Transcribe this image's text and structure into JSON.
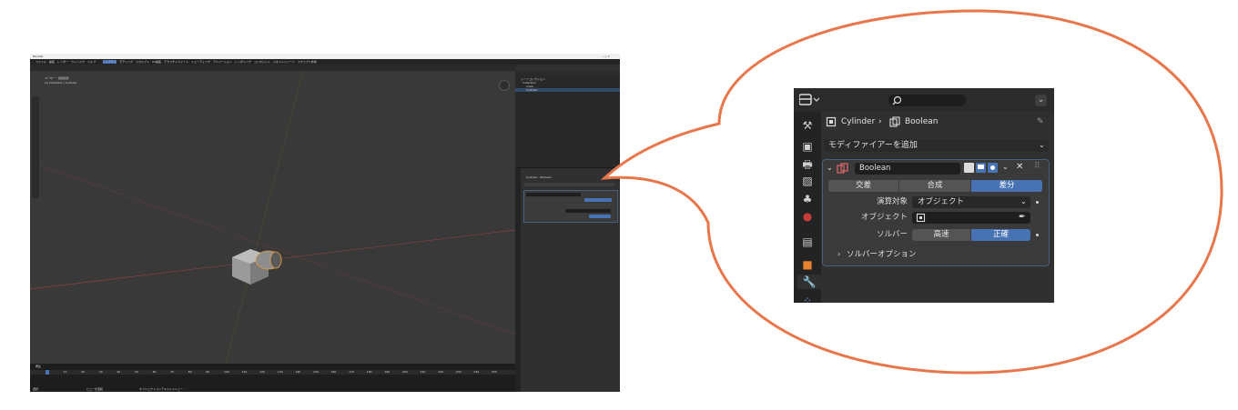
{
  "blender": {
    "title": "Blender",
    "menu": [
      "ファイル",
      "編集",
      "レンダー",
      "ウィンドウ",
      "ヘルプ"
    ],
    "workspace_tabs": [
      "レイアウト",
      "モデリング",
      "スカルプト",
      "UV編集",
      "テクスチャペイント",
      "シェーディング",
      "アニメーション",
      "レンダリング",
      "コンポジット",
      "ジオメトリノード",
      "スクリプト作成"
    ],
    "viewport_info": [
      "ユーザー・透視投影",
      "(1) Collection | Cylinder"
    ],
    "outliner_items": [
      "シーンコレクション",
      "Collection",
      "Cube",
      "Cylinder"
    ],
    "timeline_label": "再生",
    "frame_numbers": [
      "0",
      "10",
      "20",
      "30",
      "40",
      "50",
      "60",
      "70",
      "80",
      "90",
      "100",
      "110",
      "120",
      "130",
      "140",
      "150",
      "160",
      "170",
      "180",
      "190",
      "200",
      "210",
      "220",
      "230",
      "240",
      "250"
    ],
    "status_left": "選択",
    "status_mid": "ビューを回転",
    "status_right": "オブジェクトコンテキストメニュー"
  },
  "panel": {
    "breadcrumb_object": "Cylinder",
    "breadcrumb_modifier": "Boolean",
    "add_modifier_label": "モディファイアーを追加",
    "modifier_name": "Boolean",
    "operations": [
      {
        "label": "交差",
        "active": false
      },
      {
        "label": "合成",
        "active": false
      },
      {
        "label": "差分",
        "active": true
      }
    ],
    "operand_label": "演算対象",
    "operand_value": "オブジェクト",
    "object_label": "オブジェクト",
    "object_value": "",
    "solver_label": "ソルバー",
    "solvers": [
      {
        "label": "高速",
        "active": false
      },
      {
        "label": "正確",
        "active": true
      }
    ],
    "solver_options_label": "ソルバーオプション"
  },
  "colors": {
    "accent_blue": "#4772b3",
    "callout_orange": "#e8764a",
    "modifier_icon": "#e06a6a"
  }
}
